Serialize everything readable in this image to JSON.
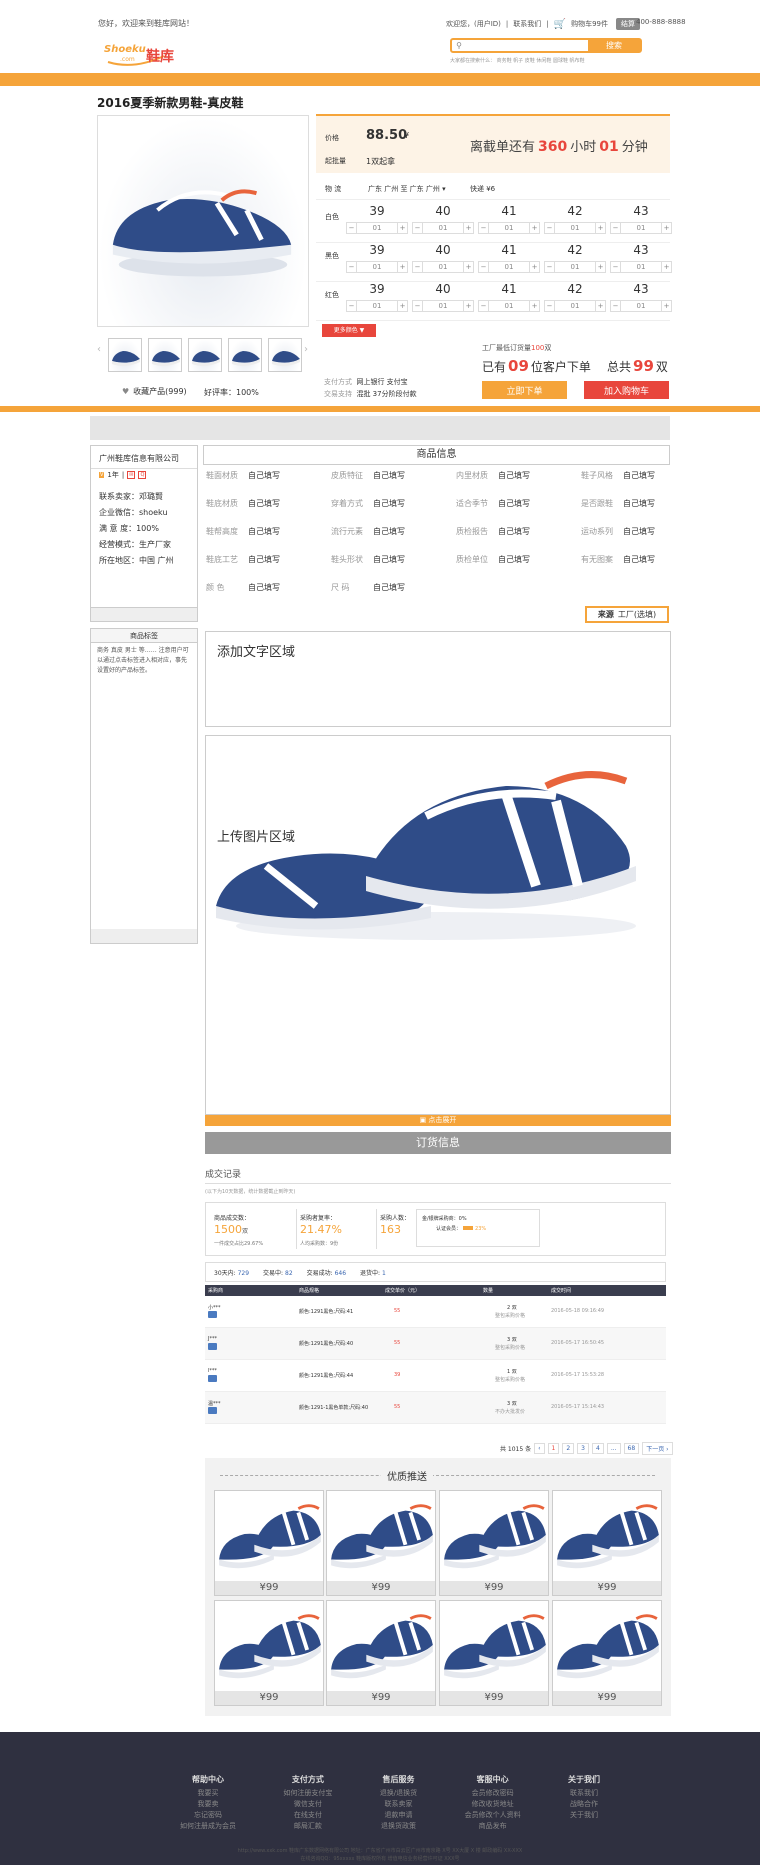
{
  "topbar": {
    "welcome": "您好，欢迎来到鞋库网站！",
    "greeting": "欢迎您，(用户ID)",
    "contact": "联系我们",
    "cart": "购物车99件",
    "checkout": "结算",
    "phone": "400-888-8888"
  },
  "logo": {
    "brand": "Shoeku",
    "sub": ".com",
    "cn": "鞋库"
  },
  "search": {
    "placeholder": "",
    "button": "搜索",
    "hints": "大家都在搜索什么：  商务鞋  帆子  皮鞋  休闲鞋  圆球鞋  帆布鞋"
  },
  "product": {
    "title": "2016夏季新款男鞋-真皮鞋",
    "price_label": "价格",
    "price": "88.50",
    "price_unit": "¥",
    "moq_label": "起批量",
    "moq": "1双起拿",
    "countdown_pre": "离截单还有",
    "countdown_hours": "360",
    "countdown_mid": "小时",
    "countdown_min": "01",
    "countdown_post": "分钟",
    "ship_label": "物  流",
    "ship_route": "广东 广州 至 广东 广州 ▾",
    "ship_fee": "快递 ¥6",
    "sizes": [
      "39",
      "40",
      "41",
      "42",
      "43"
    ],
    "colors": [
      "白色",
      "黑色",
      "红色"
    ],
    "qty": "01",
    "more_colors": "更多颜色 ▼",
    "fav": "收藏产品(999)",
    "rating": "好评率：100%",
    "pay_label": "支付方式",
    "pay_value": "网上银行 支付宝",
    "trade_label": "交易支持",
    "trade_value": "混批 37分阶段付款",
    "factory_pre": "工厂最低订货量",
    "factory_qty": "100",
    "factory_unit": "双",
    "ordered_pre": "已有",
    "ordered_num": "09",
    "ordered_post": "位客户下单",
    "total_pre": "总共",
    "total_num": "99",
    "total_unit": "双",
    "order_btn": "立即下单",
    "cart_btn": "加入购物车"
  },
  "seller": {
    "name": "广州鞋库信息有限公司",
    "years": "1年",
    "rows": [
      "联系卖家：邓璐賢",
      "企业微信：shoeku",
      "满 意 度：100%",
      "经营模式：生产厂家",
      "所在地区：中国 广州"
    ],
    "tag_title": "商品标签",
    "tag_text": "商务 真皮 男士 等……  注意用户可以通过点击标签进入相对应，事先设置好的产品标签。"
  },
  "info": {
    "title": "商品信息",
    "specs": [
      [
        "鞋面材质",
        "自己填写"
      ],
      [
        "皮质特征",
        "自己填写"
      ],
      [
        "内里材质",
        "自己填写"
      ],
      [
        "鞋子风格",
        "自己填写"
      ],
      [
        "鞋底材质",
        "自己填写"
      ],
      [
        "穿着方式",
        "自己填写"
      ],
      [
        "适合季节",
        "自己填写"
      ],
      [
        "是否跟鞋",
        "自己填写"
      ],
      [
        "鞋帮高度",
        "自己填写"
      ],
      [
        "流行元素",
        "自己填写"
      ],
      [
        "质检报告",
        "自己填写"
      ],
      [
        "运动系列",
        "自己填写"
      ],
      [
        "鞋底工艺",
        "自己填写"
      ],
      [
        "鞋头形状",
        "自己填写"
      ],
      [
        "质检单位",
        "自己填写"
      ],
      [
        "有无图案",
        "自己填写"
      ],
      [
        "颜    色",
        "自己填写"
      ],
      [
        "尺    码",
        "自己填写"
      ]
    ],
    "source_label": "来源",
    "source_value": "工厂(选填)",
    "text_area": "添加文字区域",
    "image_area": "上传图片区域",
    "expand": "点击展开",
    "order_info": "订货信息"
  },
  "records": {
    "title": "成交记录",
    "subtitle": "(以下为10天数据，统计数据截止到昨天)",
    "s1_label": "商品成交数：",
    "s1_val": "1500",
    "s1_unit": "双",
    "s1_note": "一件成交占比29.67%",
    "s2_label": "采购者复率：",
    "s2_val": "21.47%",
    "s2_note": "人均采购数：9份",
    "s3_label": "采购人数：",
    "s3_val": "163",
    "s4_a": "金/银牌采购商：0%",
    "s4_b": "认证会员：",
    "s4_c": "23%",
    "f1": "30天内:",
    "f1v": "729",
    "f2": "交易中:",
    "f2v": "82",
    "f3": "交易成功:",
    "f3v": "646",
    "f4": "退货中:",
    "f4v": "1",
    "headers": [
      "采购商",
      "商品规格",
      "成交单价（元）",
      "数量",
      "成交时间"
    ],
    "rows": [
      [
        "小***",
        "颜色:1291黑色;尺码:41",
        "55",
        "2 双",
        "整包采购价格",
        "2016-05-18 09:16:49"
      ],
      [
        "J***",
        "颜色:1291黑色;尺码:40",
        "55",
        "3 双",
        "整包采购价格",
        "2016-05-17 16:50:45"
      ],
      [
        "l***",
        "颜色:1291黑色;尺码:44",
        "39",
        "1 双",
        "整包采购价格",
        "2016-05-17 15:53:28"
      ],
      [
        "温***",
        "颜色:1291-1黑色单款;尺码:40",
        "55",
        "3 双",
        "不办大批发价",
        "2016-05-17 15:14:43"
      ]
    ],
    "total": "共 1015 条",
    "pages": [
      "‹",
      "1",
      "2",
      "3",
      "4",
      "...",
      "68",
      "下一页 ›"
    ]
  },
  "recommend": {
    "title": "优质推送",
    "price": "¥99"
  },
  "footer": {
    "cols": [
      {
        "title": "帮助中心",
        "items": [
          "我要买",
          "我要卖",
          "忘记密码",
          "如何注册成为会员"
        ]
      },
      {
        "title": "支付方式",
        "items": [
          "如何注册支付宝",
          "微信支付",
          "在线支付",
          "邮局汇款"
        ]
      },
      {
        "title": "售后服务",
        "items": [
          "退换/退换货",
          "联系卖家",
          "退款申请",
          "退换货政策"
        ]
      },
      {
        "title": "客服中心",
        "items": [
          "会员修改密码",
          "修改收货地址",
          "会员修改个人资料",
          "商品发布"
        ]
      },
      {
        "title": "关于我们",
        "items": [
          "联系我们",
          "战略合作",
          "关于我们"
        ]
      }
    ],
    "copy1": "http://www.xxk.com 鞋库广东数据网络有限公司 地址：广东省广州市白云区广州市南京路 X号 XX大厦 X 楼 邮政编码 XX-XXX",
    "copy2": "在线咨询QQ：95xxxxx 鞋库版权所有 增值电信业务经营许可证 XXX号"
  },
  "colors": {
    "accent": "#f5a43a",
    "red": "#e8463c",
    "dark": "#2f3040"
  }
}
